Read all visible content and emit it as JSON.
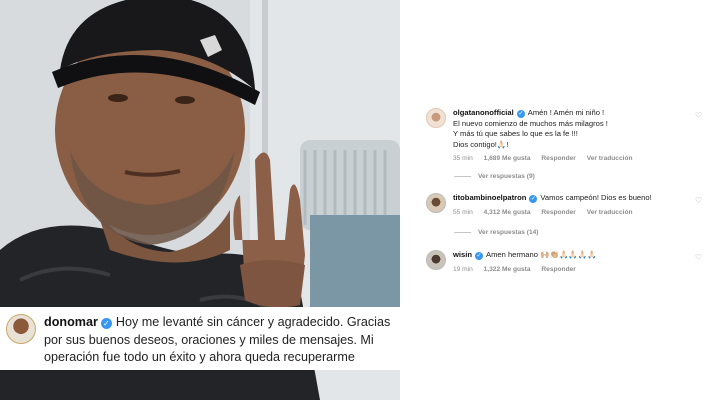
{
  "caption": {
    "username": "donomar",
    "text": "Hoy me levanté sin cáncer y agradecido. Gracias por sus buenos deseos, oraciones y miles de mensajes. Mi operación fue todo un éxito y ahora queda recuperarme"
  },
  "comments": [
    {
      "username": "olgatanonofficial",
      "lines": [
        "Amén ! Amén mi niño !",
        "El nuevo comienzo de muchos más milagros !",
        "Y más tú que sabes lo que es la fe !!!",
        "Dios contigo!🙏🏻!"
      ],
      "time": "35 min",
      "likes": "1,689 Me gusta",
      "reply": "Responder",
      "translate": "Ver traducción",
      "replies": "Ver respuestas (9)"
    },
    {
      "username": "titobambinoelpatron",
      "lines": [
        "Vamos campeón! Dios es bueno!"
      ],
      "time": "55 min",
      "likes": "4,312 Me gusta",
      "reply": "Responder",
      "translate": "Ver traducción",
      "replies": "Ver respuestas (14)"
    },
    {
      "username": "wisin",
      "lines": [
        "Amen hermano 🙌🏼👏🏼🙏🏻🙏🏻🙏🏻🙏🏻"
      ],
      "time": "19 min",
      "likes": "1,322 Me gusta",
      "reply": "Responder"
    }
  ],
  "colors": {
    "verified": "#3897f0",
    "meta": "#8e8e8e"
  }
}
